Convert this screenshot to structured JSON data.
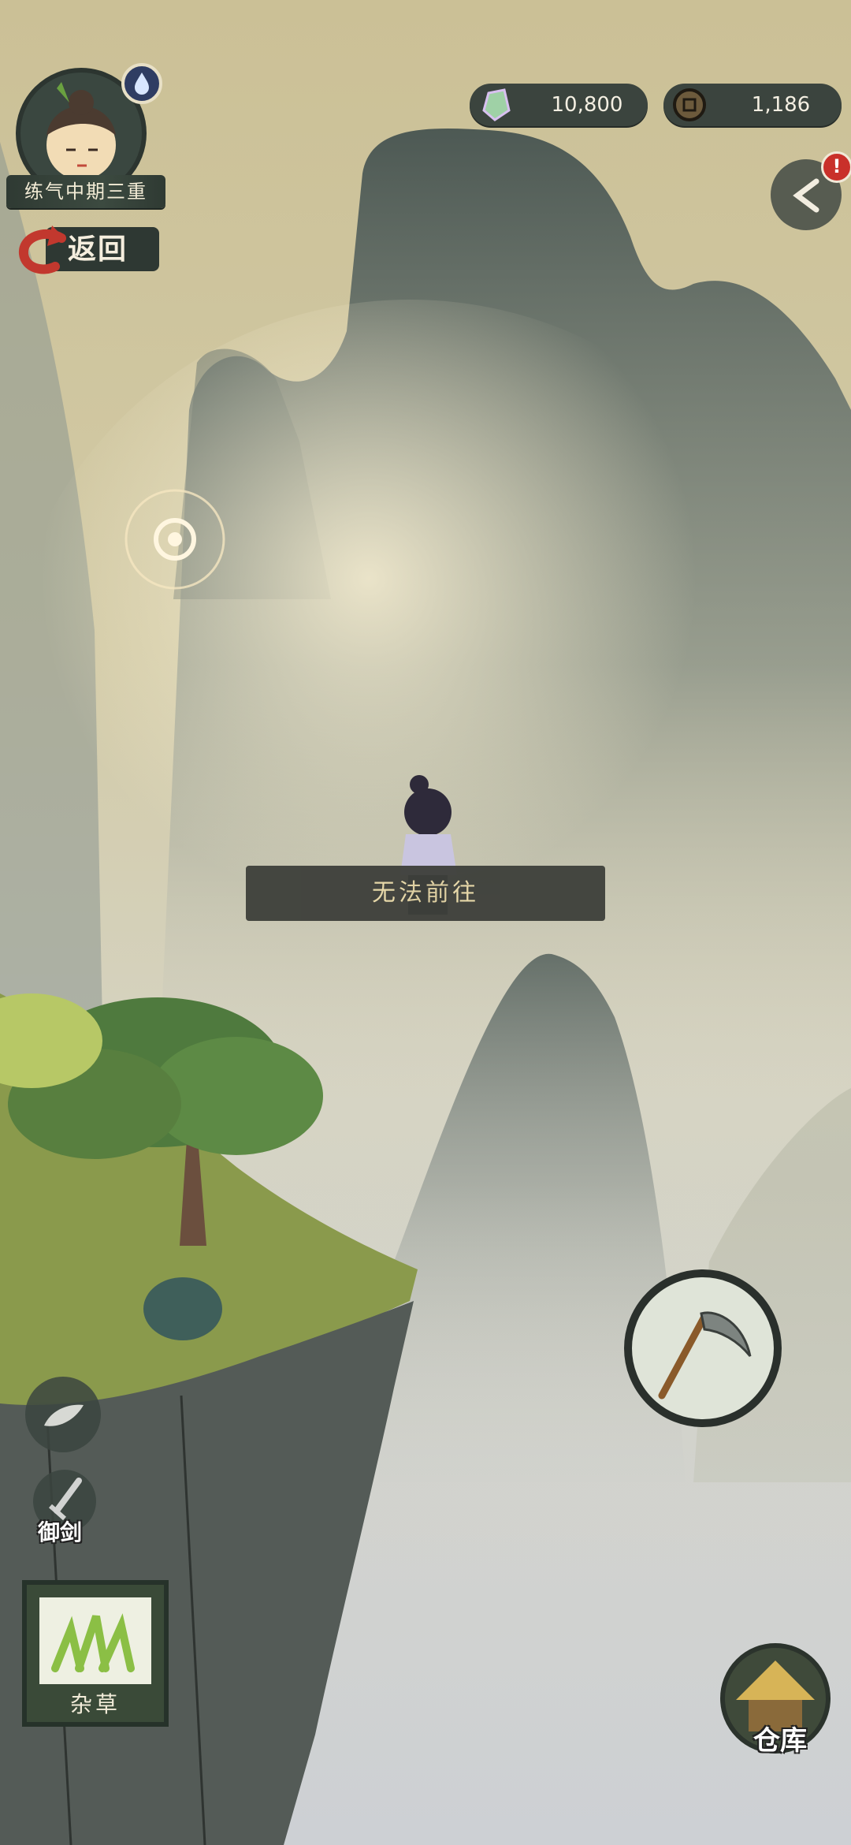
{
  "player": {
    "rank": "练气中期三重",
    "avatar_icon": "cultivator-avatar",
    "buff_icon": "water-drop-icon"
  },
  "nav": {
    "back_label": "返回"
  },
  "currency": {
    "spirit_stones": "10,800",
    "coins": "1,186"
  },
  "toast": {
    "message": "无法前往"
  },
  "actions": {
    "harvest_icon": "scythe-icon",
    "warehouse_label": "仓库",
    "flying_sword_label": "御剑",
    "selected_item_label": "杂草"
  },
  "colors": {
    "sky": "#d4c9a3",
    "mountain": "#4f5a55",
    "toast_bg": "#3d3f3a",
    "toast_text": "#e8d8a8",
    "alert": "#c9302a"
  }
}
